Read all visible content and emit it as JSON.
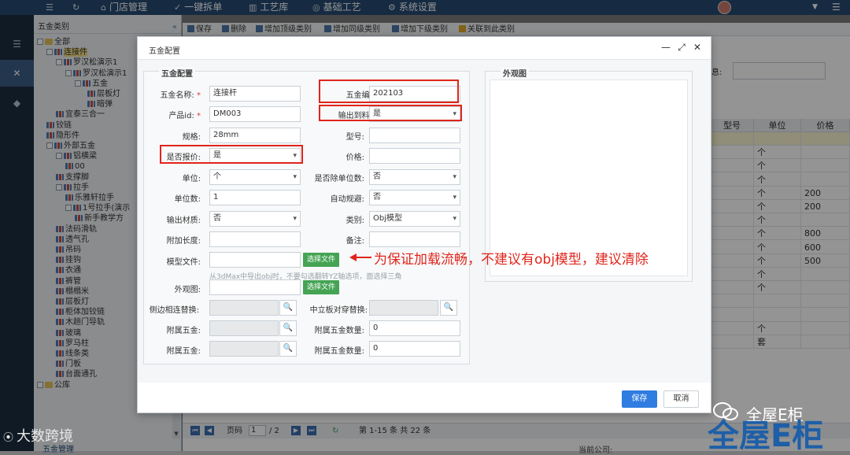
{
  "topbar": {
    "items": [
      {
        "icon": "menu-icon",
        "glyph": "☰",
        "label": ""
      },
      {
        "icon": "refresh-icon",
        "glyph": "↻",
        "label": ""
      },
      {
        "icon": "home-icon",
        "glyph": "⌂",
        "label": "门店管理"
      },
      {
        "icon": "check-icon",
        "glyph": "✓",
        "label": "一键拆单"
      },
      {
        "icon": "book-icon",
        "glyph": "▥",
        "label": "工艺库"
      },
      {
        "icon": "palette-icon",
        "glyph": "◎",
        "label": "基础工艺"
      },
      {
        "icon": "gear-icon",
        "glyph": "⚙",
        "label": "系统设置"
      }
    ]
  },
  "sidebar": {
    "icons": [
      {
        "name": "filter-icon",
        "glyph": "☰"
      },
      {
        "name": "tools-icon",
        "glyph": "✕"
      },
      {
        "name": "cube-icon",
        "glyph": "◆"
      }
    ]
  },
  "tree": {
    "title": "五金类别",
    "collapse": "«",
    "nodes": [
      {
        "label": "全部",
        "icon": "folder"
      },
      {
        "label": "连接件",
        "icon": "bars"
      },
      {
        "label": "罗汉松演示1",
        "icon": "bars"
      },
      {
        "label": "罗汉松演示1",
        "icon": "bars"
      },
      {
        "label": "五金",
        "icon": "bars"
      },
      {
        "label": "层板灯",
        "icon": "bars"
      },
      {
        "label": "暗弹",
        "icon": "bars"
      },
      {
        "label": "宜泰三合一",
        "icon": "bars"
      },
      {
        "label": "铰链",
        "icon": "bars"
      },
      {
        "label": "隐形件",
        "icon": "bars"
      },
      {
        "label": "外部五金",
        "icon": "bars"
      },
      {
        "label": "铝横梁",
        "icon": "bars"
      },
      {
        "label": "00",
        "icon": "bars"
      },
      {
        "label": "支撑脚",
        "icon": "bars"
      },
      {
        "label": "拉手",
        "icon": "bars"
      },
      {
        "label": "乐雅轩拉手",
        "icon": "bars"
      },
      {
        "label": "1号拉手(演示",
        "icon": "bars"
      },
      {
        "label": "新手教学方",
        "icon": "bars"
      },
      {
        "label": "法码滑轨",
        "icon": "bars"
      },
      {
        "label": "透气孔",
        "icon": "bars"
      },
      {
        "label": "吊码",
        "icon": "bars"
      },
      {
        "label": "挂钩",
        "icon": "bars"
      },
      {
        "label": "衣通",
        "icon": "bars"
      },
      {
        "label": "裤管",
        "icon": "bars"
      },
      {
        "label": "榻榻米",
        "icon": "bars"
      },
      {
        "label": "层板灯",
        "icon": "bars"
      },
      {
        "label": "柜体加铰链",
        "icon": "bars"
      },
      {
        "label": "木趟门导轨",
        "icon": "bars"
      },
      {
        "label": "玻璃",
        "icon": "bars"
      },
      {
        "label": "罗马柱",
        "icon": "bars"
      },
      {
        "label": "线条类",
        "icon": "bars"
      },
      {
        "label": "门板",
        "icon": "bars"
      },
      {
        "label": "台面通孔",
        "icon": "bars"
      },
      {
        "label": "公库",
        "icon": "folder"
      }
    ]
  },
  "toolbar": {
    "buttons": [
      "保存",
      "删除",
      "增加顶级类别",
      "增加同级类别",
      "增加下级类别",
      "关联到此类别"
    ]
  },
  "background": {
    "note_label": "息:",
    "columns": [
      "型号",
      "单位",
      "价格"
    ],
    "rows": [
      {
        "unit": "",
        "price": ""
      },
      {
        "unit": "个",
        "price": ""
      },
      {
        "unit": "个",
        "price": ""
      },
      {
        "unit": "个",
        "price": ""
      },
      {
        "unit": "个",
        "price": "200"
      },
      {
        "unit": "个",
        "price": "200"
      },
      {
        "unit": "个",
        "price": ""
      },
      {
        "unit": "个",
        "price": "800"
      },
      {
        "unit": "个",
        "price": "600"
      },
      {
        "unit": "个",
        "price": "500"
      },
      {
        "unit": "个",
        "price": ""
      },
      {
        "unit": "个",
        "price": ""
      },
      {
        "unit": "",
        "price": ""
      },
      {
        "unit": "",
        "price": ""
      },
      {
        "unit": "个",
        "price": ""
      },
      {
        "unit": "套",
        "price": ""
      }
    ],
    "pager": {
      "page_label": "页码",
      "page": "1",
      "total_pages": "/ 2",
      "summary": "第 1-15 条   共 22 条"
    },
    "bottom_tab": "五金管理",
    "company_label": "当前公司:"
  },
  "modal": {
    "title": "五金配置",
    "controls": {
      "minimize": "—",
      "maximize": "⤢",
      "close": "✕"
    },
    "section_title": "五金配置",
    "appearance_title": "外观图",
    "fields": {
      "name_label": "五金名称:",
      "name_value": "连接杆",
      "code_label": "五金编码:",
      "code_value": "202103",
      "product_label": "产品id:",
      "product_value": "DM003",
      "output_label": "输出到料单:",
      "output_value": "是",
      "spec_label": "规格:",
      "spec_value": "28mm",
      "model_label": "型号:",
      "model_value": "",
      "quote_label": "是否报价:",
      "quote_value": "是",
      "price_label": "价格:",
      "price_value": "",
      "unit_label": "单位:",
      "unit_value": "个",
      "divide_label": "是否除单位数:",
      "divide_value": "否",
      "unitcount_label": "单位数:",
      "unitcount_value": "1",
      "avoid_label": "自动规避:",
      "avoid_value": "否",
      "material_label": "输出材质:",
      "material_value": "否",
      "category_label": "类别:",
      "category_value": "Obj模型",
      "extra_label": "附加长度:",
      "extra_value": "",
      "remark_label": "备注:",
      "remark_value": "",
      "modelfile_label": "模型文件:",
      "modelfile_value": "",
      "select_file": "选择文件",
      "hint": "从3dMax中导出obj时，不要勾选翻转YZ轴选项，面选择三角",
      "appearance_label": "外观图:",
      "appearance_value": "",
      "side_replace_label": "侧边相连替换:",
      "side_replace_value": "",
      "mid_replace_label": "中立板对穿替换:",
      "mid_replace_value": "",
      "attach1_label": "附属五金:",
      "attach1_value": "",
      "attach1_qty_label": "附属五金数量:",
      "attach1_qty_value": "0",
      "attach2_label": "附属五金:",
      "attach2_value": "",
      "attach2_qty_label": "附属五金数量:",
      "attach2_qty_value": "0"
    },
    "required_mark": "*",
    "annotation": "为保证加载流畅，不建议有obj模型，建议清除",
    "save": "保存",
    "cancel": "取消"
  },
  "watermarks": {
    "left": "大数跨境",
    "right_text": "全屋E柜",
    "right_logo": "全屋E柜"
  },
  "colors": {
    "topbar": "#274a73",
    "sidebar": "#1d2d3e",
    "primary_button": "#2f7de1",
    "file_button": "#45a454",
    "annotation_red": "#e0251b"
  }
}
